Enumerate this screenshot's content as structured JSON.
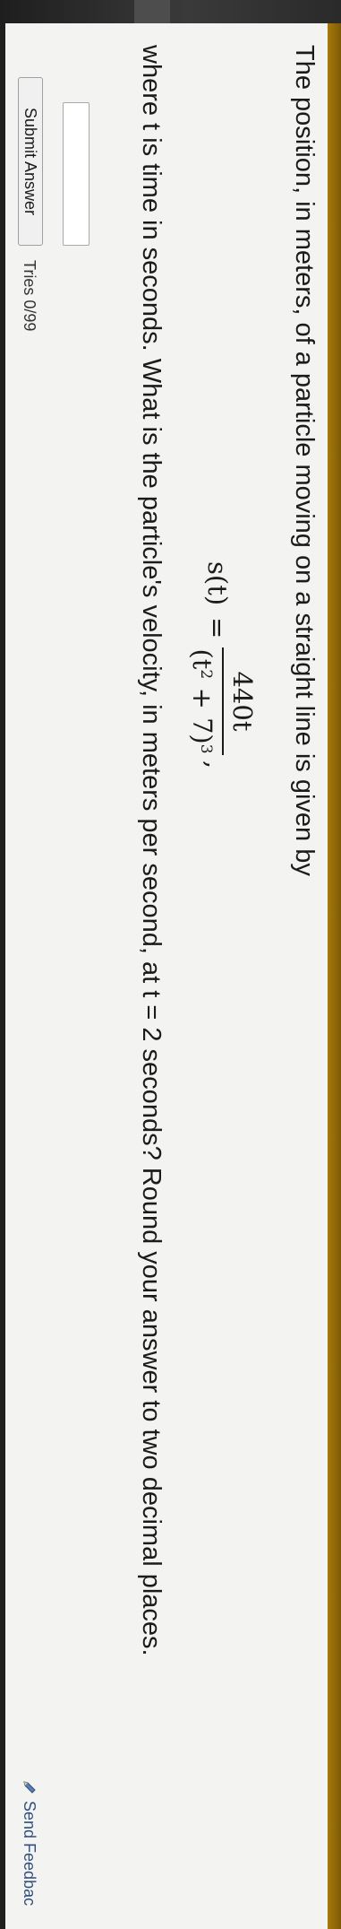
{
  "problem": {
    "statement": "The position, in meters, of a particle moving on a straight line is given by",
    "formula": {
      "lhs": "s(t)",
      "equals": "=",
      "numerator": "440t",
      "den_open": "(t",
      "den_exp1": "2",
      "den_mid": " + 7)",
      "den_exp2": "3",
      "trailing": ","
    },
    "question": "where t is time in seconds. What is the particle's velocity, in meters per second, at t = 2 seconds? Round your answer to two decimal places."
  },
  "answer": {
    "input_value": "",
    "placeholder": "",
    "submit_label": "Submit Answer",
    "tries_text": "Tries 0/99"
  },
  "footer": {
    "feedback_label": "Send Feedbac",
    "icon": "pencil-icon"
  },
  "colors": {
    "paper": "#f3f3f1",
    "frame": "#8a6508",
    "text": "#1b1b1b",
    "link": "#2f4f7f"
  }
}
